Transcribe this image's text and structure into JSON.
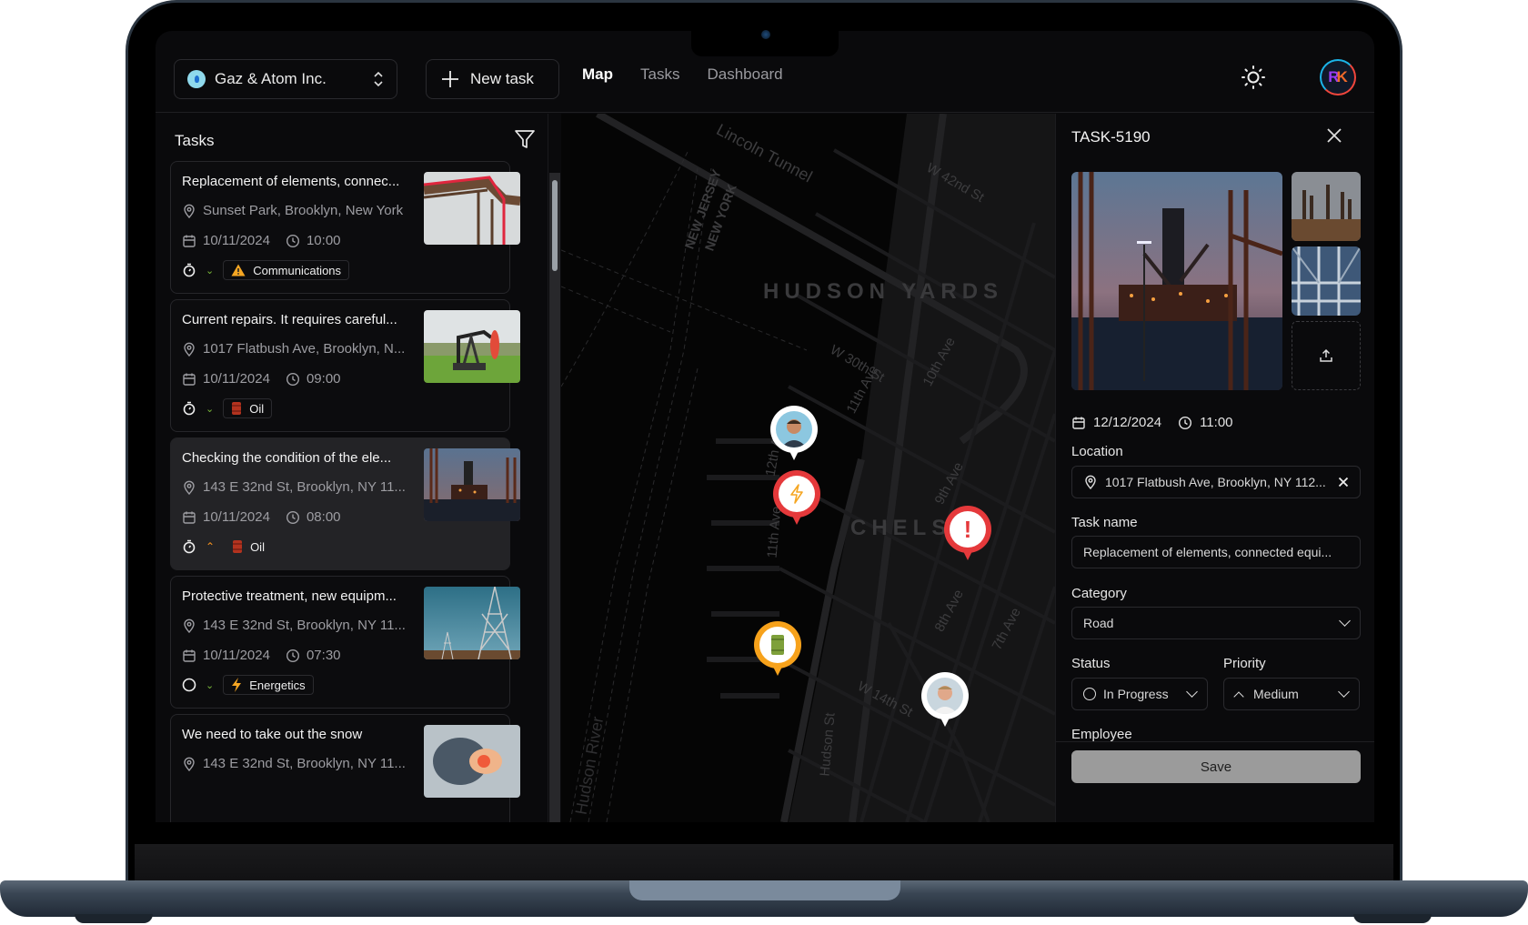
{
  "header": {
    "org_name": "Gaz & Atom Inc.",
    "new_task_label": "New task",
    "nav": [
      {
        "label": "Map",
        "active": true
      },
      {
        "label": "Tasks",
        "active": false
      },
      {
        "label": "Dashboard",
        "active": false
      }
    ],
    "theme_icon": "sun-icon",
    "user_initials_r": "R",
    "user_initials_k": "K"
  },
  "tasks_panel": {
    "title": "Tasks",
    "filter_icon": "filter-icon",
    "tasks": [
      {
        "title": "Replacement of elements, connec...",
        "address": "Sunset Park, Brooklyn, New York",
        "date": "10/11/2024",
        "time": "10:00",
        "status_icon": "timer-icon",
        "priority": "low",
        "category": "Communications",
        "category_icon": "warning-icon",
        "selected": false
      },
      {
        "title": "Current repairs. It requires careful...",
        "address": "1017 Flatbush Ave, Brooklyn, N...",
        "date": "10/11/2024",
        "time": "09:00",
        "status_icon": "timer-icon",
        "priority": "low",
        "category": "Oil",
        "category_icon": "oil-barrel-icon",
        "selected": false
      },
      {
        "title": "Checking the condition of the ele...",
        "address": "143 E 32nd St, Brooklyn, NY 11...",
        "date": "10/11/2024",
        "time": "08:00",
        "status_icon": "timer-icon",
        "priority": "medium",
        "category": "Oil",
        "category_icon": "oil-barrel-icon",
        "selected": true
      },
      {
        "title": "Protective treatment, new equipm...",
        "address": "143 E 32nd St, Brooklyn, NY 11...",
        "date": "10/11/2024",
        "time": "07:30",
        "status_icon": "circle-icon",
        "priority": "low",
        "category": "Energetics",
        "category_icon": "lightning-icon",
        "selected": false
      },
      {
        "title": "We need to take out the snow",
        "address": "143 E 32nd St, Brooklyn, NY 11...",
        "date": "",
        "time": "",
        "status_icon": "",
        "priority": "",
        "category": "",
        "category_icon": "",
        "selected": false
      }
    ]
  },
  "map": {
    "labels": {
      "tunnel": "Lincoln Tunnel",
      "w42": "W 42nd St",
      "nj": "NEW JERSEY",
      "ny": "NEW YORK",
      "hudson_yards": "HUDSON YARDS",
      "w30": "W 30th St",
      "tenth": "10th Ave",
      "twelfth": "12th Ave",
      "eleventh": "11th Ave",
      "eleventh2": "11th Ave",
      "ninth": "9th Ave",
      "chelsea": "CHELSEA",
      "eighth": "8th Ave",
      "seventh": "7th Ave",
      "w14": "W 14th St",
      "hudson_st": "Hudson St",
      "hudson_river": "Hudson River"
    },
    "pins": [
      {
        "type": "employee",
        "icon": "employee-avatar-icon",
        "color": "#ffffff"
      },
      {
        "type": "task",
        "icon": "lightning-icon",
        "color": "#e5393b"
      },
      {
        "type": "task",
        "icon": "exclamation-icon",
        "color": "#e5393b",
        "glyph": "!"
      },
      {
        "type": "task",
        "icon": "oil-barrel-icon",
        "color": "#f7a21b"
      },
      {
        "type": "employee",
        "icon": "employee-avatar-icon",
        "color": "#ffffff"
      }
    ]
  },
  "detail": {
    "title": "TASK-5190",
    "date": "12/12/2024",
    "time": "11:00",
    "location_label": "Location",
    "location_value": "1017 Flatbush Ave, Brooklyn, NY 112...",
    "task_name_label": "Task name",
    "task_name_value": "Replacement of elements, connected equi...",
    "category_label": "Category",
    "category_value": "Road",
    "status_label": "Status",
    "status_value": "In Progress",
    "priority_label": "Priority",
    "priority_value": "Medium",
    "employee_label": "Employee",
    "save_label": "Save"
  },
  "colors": {
    "accent_red": "#e5393b",
    "accent_orange": "#f7a21b",
    "priority_low": "#7ab83a",
    "priority_medium": "#f7931e"
  }
}
